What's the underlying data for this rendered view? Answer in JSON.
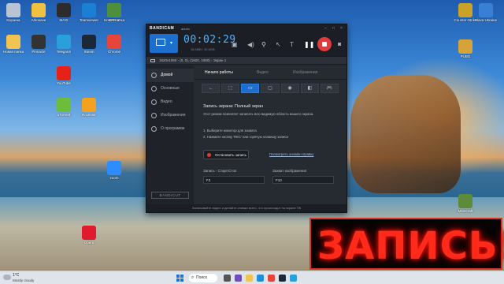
{
  "desktop": {
    "icons": [
      {
        "label": "Корзина",
        "color": "#b8c4d4"
      },
      {
        "label": "Arkosave",
        "color": "#f0c040"
      },
      {
        "label": "MAXI",
        "color": "#2c2c2c"
      },
      {
        "label": "Teamviewer",
        "color": "#1b7fd3"
      },
      {
        "label": "Новая папка",
        "color": "#f1c452"
      },
      {
        "label": "Новая папка",
        "color": "#f1c452"
      },
      {
        "label": "Pinnacle",
        "color": "#333"
      },
      {
        "label": "Telegram",
        "color": "#2aa0db"
      },
      {
        "label": "Steam",
        "color": "#1b2838"
      },
      {
        "label": "Chrome",
        "color": "#e7443a"
      },
      {
        "label": "YouTube",
        "color": "#e62117"
      },
      {
        "label": "uTorrent",
        "color": "#6bbd3b"
      },
      {
        "label": "Rockstar",
        "color": "#f4a11d"
      },
      {
        "label": "zoom",
        "color": "#2d8cff"
      },
      {
        "label": "Opera",
        "color": "#e01b2f"
      },
      {
        "label": "GTA V",
        "color": "#4d8f3a"
      },
      {
        "label": "Counter-Strike",
        "color": "#c9a227"
      },
      {
        "label": "Slava Ukraine",
        "color": "#3a7fd6"
      },
      {
        "label": "PUBG",
        "color": "#d6a23a"
      },
      {
        "label": "Minecraft",
        "color": "#5c8b3a"
      }
    ]
  },
  "bandicam": {
    "brand": "BANDICAM",
    "admin_label": "admin",
    "timer": "00:02:29",
    "file_size": "18.4MB / 32.5GB",
    "window_buttons": [
      "–",
      "□",
      "×"
    ],
    "target_text": "1920x1080 - (0, 0), (1920, 1080) - Экран 1",
    "nav": [
      "Домой",
      "Основные",
      "Видео",
      "Изображения",
      "О программе"
    ],
    "cut_label": "BANDICUT",
    "tabs": [
      "Начало работы",
      "Видео",
      "Изображения"
    ],
    "modes": [
      "←",
      "⬚",
      "▭",
      "▢",
      "◉",
      "◧",
      "🎮"
    ],
    "heading": "Запись экрана: Полный экран",
    "description": "Этот режим позволяет записать всю видимую область вашего экрана.",
    "steps": [
      "1. Выберите монитор для захвата",
      "2. Нажмите кнопку 'REC' или горячую клавишу записи"
    ],
    "stop_button": "Остановить запись",
    "help_link": "Посмотреть онлайн-справку",
    "hotkey_record_label": "Запись - Старт/Стоп",
    "hotkey_record_value": "F2",
    "hotkey_image_label": "Захват изображения",
    "hotkey_image_value": "F10",
    "footer": "Записывайте видео и делайте снимки всего, что происходит на экране ПК"
  },
  "overlay": {
    "text": "ЗАПИСЬ!"
  },
  "taskbar": {
    "temp": "1°C",
    "weather": "Mostly cloudy",
    "search_label": "Поиск"
  }
}
